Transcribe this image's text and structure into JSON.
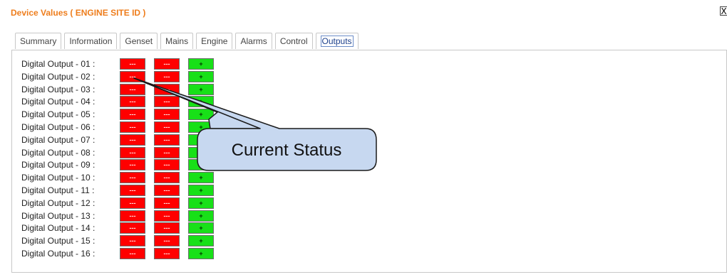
{
  "window": {
    "title": "Device Values ( ENGINE SITE ID )",
    "close_label": "X"
  },
  "tabs": [
    "Summary",
    "Information",
    "Genset",
    "Mains",
    "Engine",
    "Alarms",
    "Control",
    "Outputs"
  ],
  "active_tab": "Outputs",
  "outputs": [
    {
      "label": "Digital Output - 01 :",
      "c1": "---",
      "c2": "---",
      "c3": "+"
    },
    {
      "label": "Digital Output - 02 :",
      "c1": "---",
      "c2": "---",
      "c3": "+"
    },
    {
      "label": "Digital Output - 03 :",
      "c1": "---",
      "c2": "---",
      "c3": "+"
    },
    {
      "label": "Digital Output - 04 :",
      "c1": "---",
      "c2": "---",
      "c3": "+"
    },
    {
      "label": "Digital Output - 05 :",
      "c1": "---",
      "c2": "---",
      "c3": "+"
    },
    {
      "label": "Digital Output - 06 :",
      "c1": "---",
      "c2": "---",
      "c3": "+"
    },
    {
      "label": "Digital Output - 07 :",
      "c1": "---",
      "c2": "---",
      "c3": "+"
    },
    {
      "label": "Digital Output - 08 :",
      "c1": "---",
      "c2": "---",
      "c3": "+"
    },
    {
      "label": "Digital Output - 09 :",
      "c1": "---",
      "c2": "---",
      "c3": "+"
    },
    {
      "label": "Digital Output - 10 :",
      "c1": "---",
      "c2": "---",
      "c3": "+"
    },
    {
      "label": "Digital Output - 11 :",
      "c1": "---",
      "c2": "---",
      "c3": "+"
    },
    {
      "label": "Digital Output - 12 :",
      "c1": "---",
      "c2": "---",
      "c3": "+"
    },
    {
      "label": "Digital Output - 13 :",
      "c1": "---",
      "c2": "---",
      "c3": "+"
    },
    {
      "label": "Digital Output - 14 :",
      "c1": "---",
      "c2": "---",
      "c3": "+"
    },
    {
      "label": "Digital Output - 15 :",
      "c1": "---",
      "c2": "---",
      "c3": "+"
    },
    {
      "label": "Digital Output - 16 :",
      "c1": "---",
      "c2": "---",
      "c3": "+"
    }
  ],
  "callout": {
    "text": "Current Status"
  },
  "colors": {
    "title": "#ee7d1c",
    "off": "#ff0000",
    "on": "#18e018",
    "callout_fill": "#c7d8f0",
    "callout_border": "#1a1a1a"
  }
}
